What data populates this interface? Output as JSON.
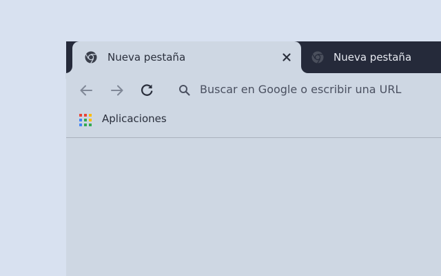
{
  "tabs": [
    {
      "title": "Nueva pestaña",
      "active": true,
      "favicon": "chrome-logo-icon"
    },
    {
      "title": "Nueva pestaña",
      "active": false,
      "favicon": "chrome-logo-icon"
    }
  ],
  "toolbar": {
    "back_icon": "arrow-left-icon",
    "forward_icon": "arrow-right-icon",
    "reload_icon": "reload-icon",
    "search_icon": "search-icon",
    "omnibox_placeholder": "Buscar en Google o escribir una URL"
  },
  "bookmarks": {
    "apps_icon": "apps-grid-icon",
    "apps_label": "Aplicaciones"
  },
  "colors": {
    "page_background": "#d8e1f0",
    "tabstrip": "#252a3a",
    "toolbar": "#ced7e3",
    "active_text": "#2a2f3c",
    "inactive_text": "#e6e9f0"
  }
}
